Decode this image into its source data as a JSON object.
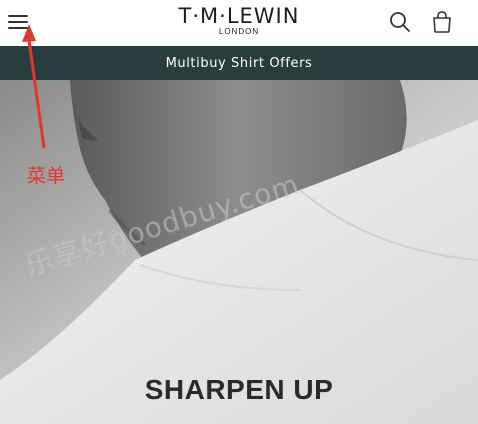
{
  "header": {
    "brand": "T·M·LEWIN",
    "brand_sub": "LONDON",
    "menu_icon": "hamburger-menu-icon",
    "search_icon": "search-icon",
    "cart_icon": "shopping-bag-icon"
  },
  "banner": {
    "text": "Multibuy Shirt Offers",
    "background": "#283d3d"
  },
  "hero": {
    "title": "SHARPEN UP"
  },
  "annotation": {
    "label": "菜单",
    "color": "#e2382b"
  },
  "watermark": {
    "text": "乐享好goodbuy.com"
  }
}
